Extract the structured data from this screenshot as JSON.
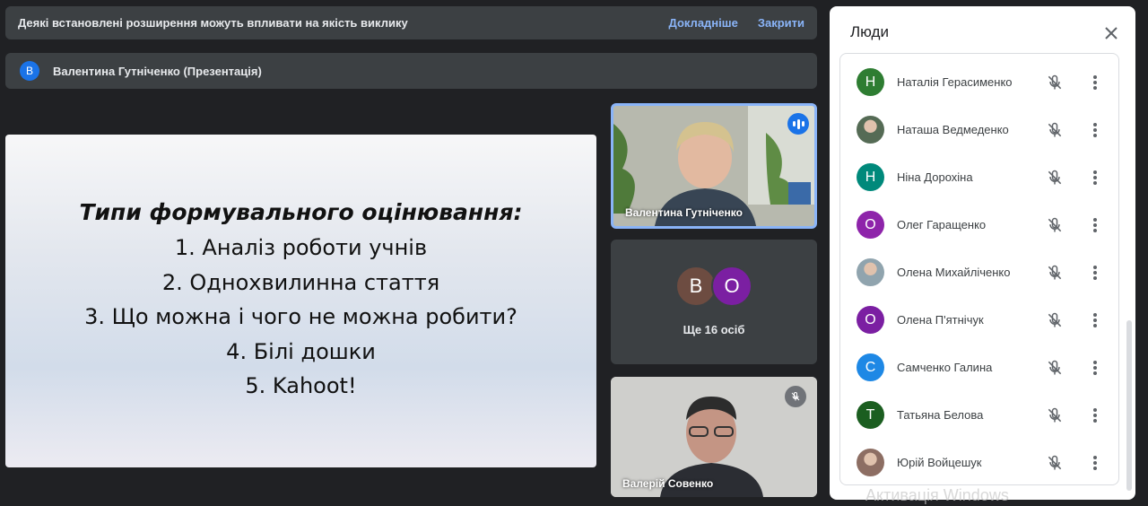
{
  "notification": {
    "text": "Деякі встановлені розширення можуть впливати на якість виклику",
    "learn_more": "Докладніше",
    "close": "Закрити"
  },
  "presenter": {
    "initial": "В",
    "label": "Валентина Гутніченко (Презентація)"
  },
  "slide": {
    "title": "Типи формувального оцінювання:",
    "items": [
      "1. Аналіз роботи учнів",
      "2. Однохвилинна стаття",
      "3. Що можна і чого не можна робити?",
      "4. Білі дошки",
      "5. Kahoot!"
    ]
  },
  "tiles": {
    "main_speaker": "Валентина Гутніченко",
    "others": {
      "avatars": [
        {
          "initial": "В",
          "color": "#6d4c41"
        },
        {
          "initial": "О",
          "color": "#7b1fa2"
        }
      ],
      "label": "Ще 16 осіб"
    },
    "camera": "Валерій Совенко"
  },
  "people_panel": {
    "title": "Люди",
    "people": [
      {
        "name": "Наталія Герасименко",
        "initial": "Н",
        "color": "#2e7d32",
        "photo": false
      },
      {
        "name": "Наташа Ведмеденко",
        "initial": "",
        "color": "#556b55",
        "photo": true
      },
      {
        "name": "Ніна Дорохіна",
        "initial": "Н",
        "color": "#00897b",
        "photo": false
      },
      {
        "name": "Олег Гаращенко",
        "initial": "О",
        "color": "#8e24aa",
        "photo": false
      },
      {
        "name": "Олена Михайліченко",
        "initial": "",
        "color": "#90a4ae",
        "photo": true
      },
      {
        "name": "Олена П'ятнічук",
        "initial": "О",
        "color": "#7b1fa2",
        "photo": false
      },
      {
        "name": "Самченко Галина",
        "initial": "С",
        "color": "#1e88e5",
        "photo": false
      },
      {
        "name": "Татьяна Белова",
        "initial": "Т",
        "color": "#1b5e20",
        "photo": false
      },
      {
        "name": "Юрій Войцешук",
        "initial": "",
        "color": "#8d6e63",
        "photo": true
      }
    ]
  },
  "os_watermark": "Активація Windows"
}
